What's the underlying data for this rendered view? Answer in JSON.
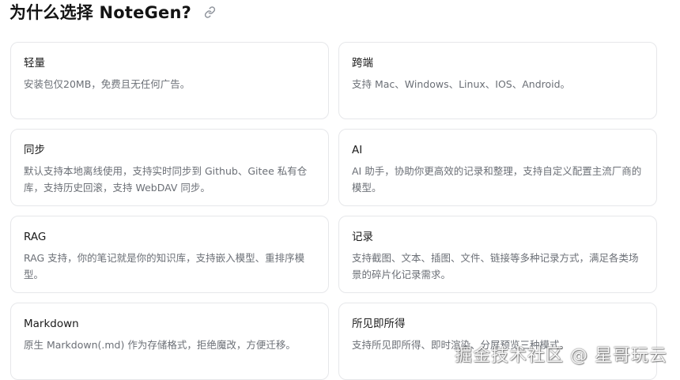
{
  "section": {
    "heading": "为什么选择 NoteGen?",
    "anchor_icon": "link-icon"
  },
  "features": [
    {
      "title": "轻量",
      "desc": "安装包仅20MB，免费且无任何广告。"
    },
    {
      "title": "跨端",
      "desc": "支持 Mac、Windows、Linux、IOS、Android。"
    },
    {
      "title": "同步",
      "desc": "默认支持本地离线使用，支持实时同步到 Github、Gitee 私有仓库，支持历史回滚，支持 WebDAV 同步。"
    },
    {
      "title": "AI",
      "desc": "AI 助手，协助你更高效的记录和整理，支持自定义配置主流厂商的模型。"
    },
    {
      "title": "RAG",
      "desc": "RAG 支持，你的笔记就是你的知识库，支持嵌入模型、重排序模型。"
    },
    {
      "title": "记录",
      "desc": "支持截图、文本、插图、文件、链接等多种记录方式，满足各类场景的碎片化记录需求。"
    },
    {
      "title": "Markdown",
      "desc": "原生 Markdown(.md) 作为存储格式，拒绝魔改，方便迁移。"
    },
    {
      "title": "所见即所得",
      "desc": "支持所见即所得、即时渲染、分屏预览三种模式。"
    }
  ],
  "watermark": "掘金技术社区 @ 星哥玩云",
  "colors": {
    "card_border": "#e6e7ea",
    "desc_text": "#6b6f76",
    "title_text": "#1a1a1a"
  }
}
